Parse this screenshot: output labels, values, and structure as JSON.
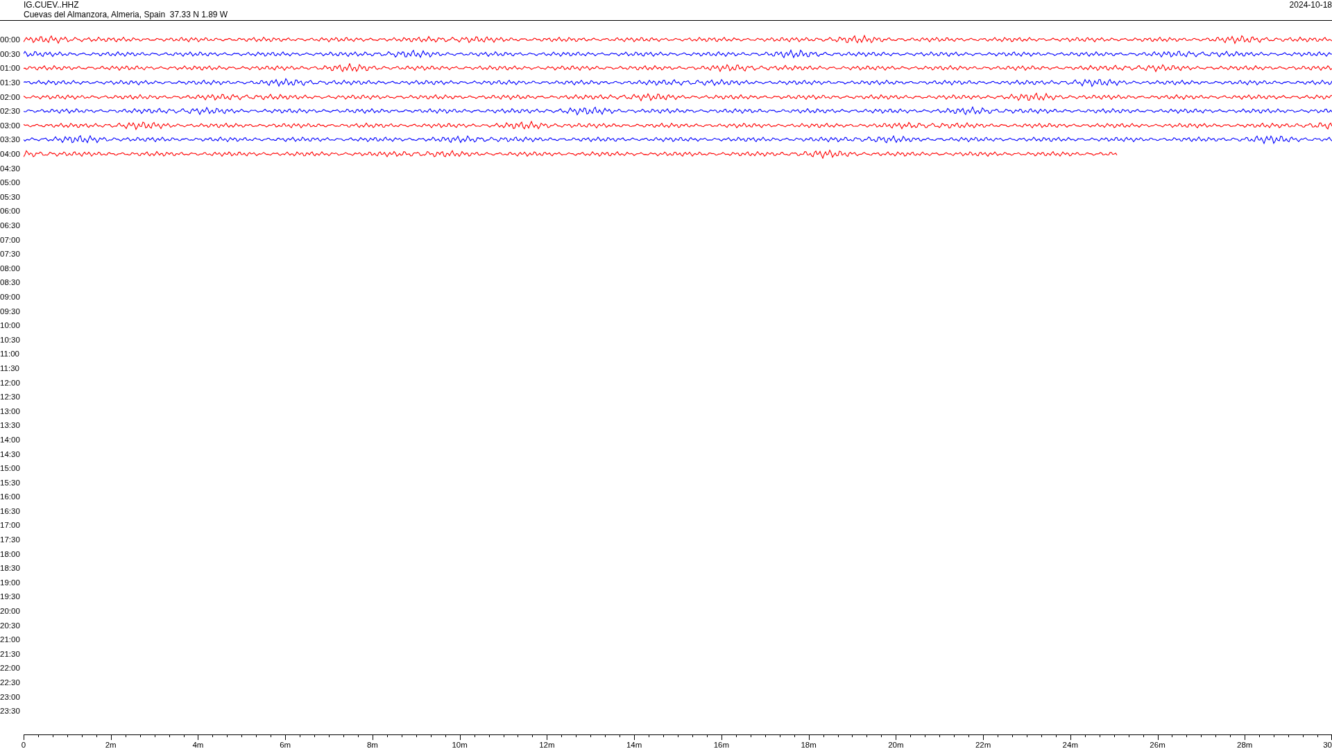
{
  "header": {
    "station": "IG.CUEV..HHZ",
    "location": "Cuevas del Almanzora, Almeria, Spain  37.33 N 1.89 W",
    "date": "2024-10-18"
  },
  "rows": [
    {
      "time": "00:00",
      "color": "#ff0000"
    },
    {
      "time": "00:30",
      "color": "#0000ff"
    },
    {
      "time": "01:00",
      "color": "#ff0000"
    },
    {
      "time": "01:30",
      "color": "#0000ff"
    },
    {
      "time": "02:00",
      "color": "#ff0000"
    },
    {
      "time": "02:30",
      "color": "#0000ff"
    },
    {
      "time": "03:00",
      "color": "#ff0000"
    },
    {
      "time": "03:30",
      "color": "#0000ff"
    },
    {
      "time": "04:00",
      "color": "#ff0000"
    },
    {
      "time": "04:30"
    },
    {
      "time": "05:00"
    },
    {
      "time": "05:30"
    },
    {
      "time": "06:00"
    },
    {
      "time": "06:30"
    },
    {
      "time": "07:00"
    },
    {
      "time": "07:30"
    },
    {
      "time": "08:00"
    },
    {
      "time": "08:30"
    },
    {
      "time": "09:00"
    },
    {
      "time": "09:30"
    },
    {
      "time": "10:00"
    },
    {
      "time": "10:30"
    },
    {
      "time": "11:00"
    },
    {
      "time": "11:30"
    },
    {
      "time": "12:00"
    },
    {
      "time": "12:30"
    },
    {
      "time": "13:00"
    },
    {
      "time": "13:30"
    },
    {
      "time": "14:00"
    },
    {
      "time": "14:30"
    },
    {
      "time": "15:00"
    },
    {
      "time": "15:30"
    },
    {
      "time": "16:00"
    },
    {
      "time": "16:30"
    },
    {
      "time": "17:00"
    },
    {
      "time": "17:30"
    },
    {
      "time": "18:00"
    },
    {
      "time": "18:30"
    },
    {
      "time": "19:00"
    },
    {
      "time": "19:30"
    },
    {
      "time": "20:00"
    },
    {
      "time": "20:30"
    },
    {
      "time": "21:00"
    },
    {
      "time": "21:30"
    },
    {
      "time": "22:00"
    },
    {
      "time": "22:30"
    },
    {
      "time": "23:00"
    },
    {
      "time": "23:30"
    }
  ],
  "axis": {
    "labels": [
      "0",
      "2m",
      "4m",
      "6m",
      "8m",
      "10m",
      "12m",
      "14m",
      "16m",
      "18m",
      "20m",
      "22m",
      "24m",
      "26m",
      "28m",
      "30"
    ]
  }
}
